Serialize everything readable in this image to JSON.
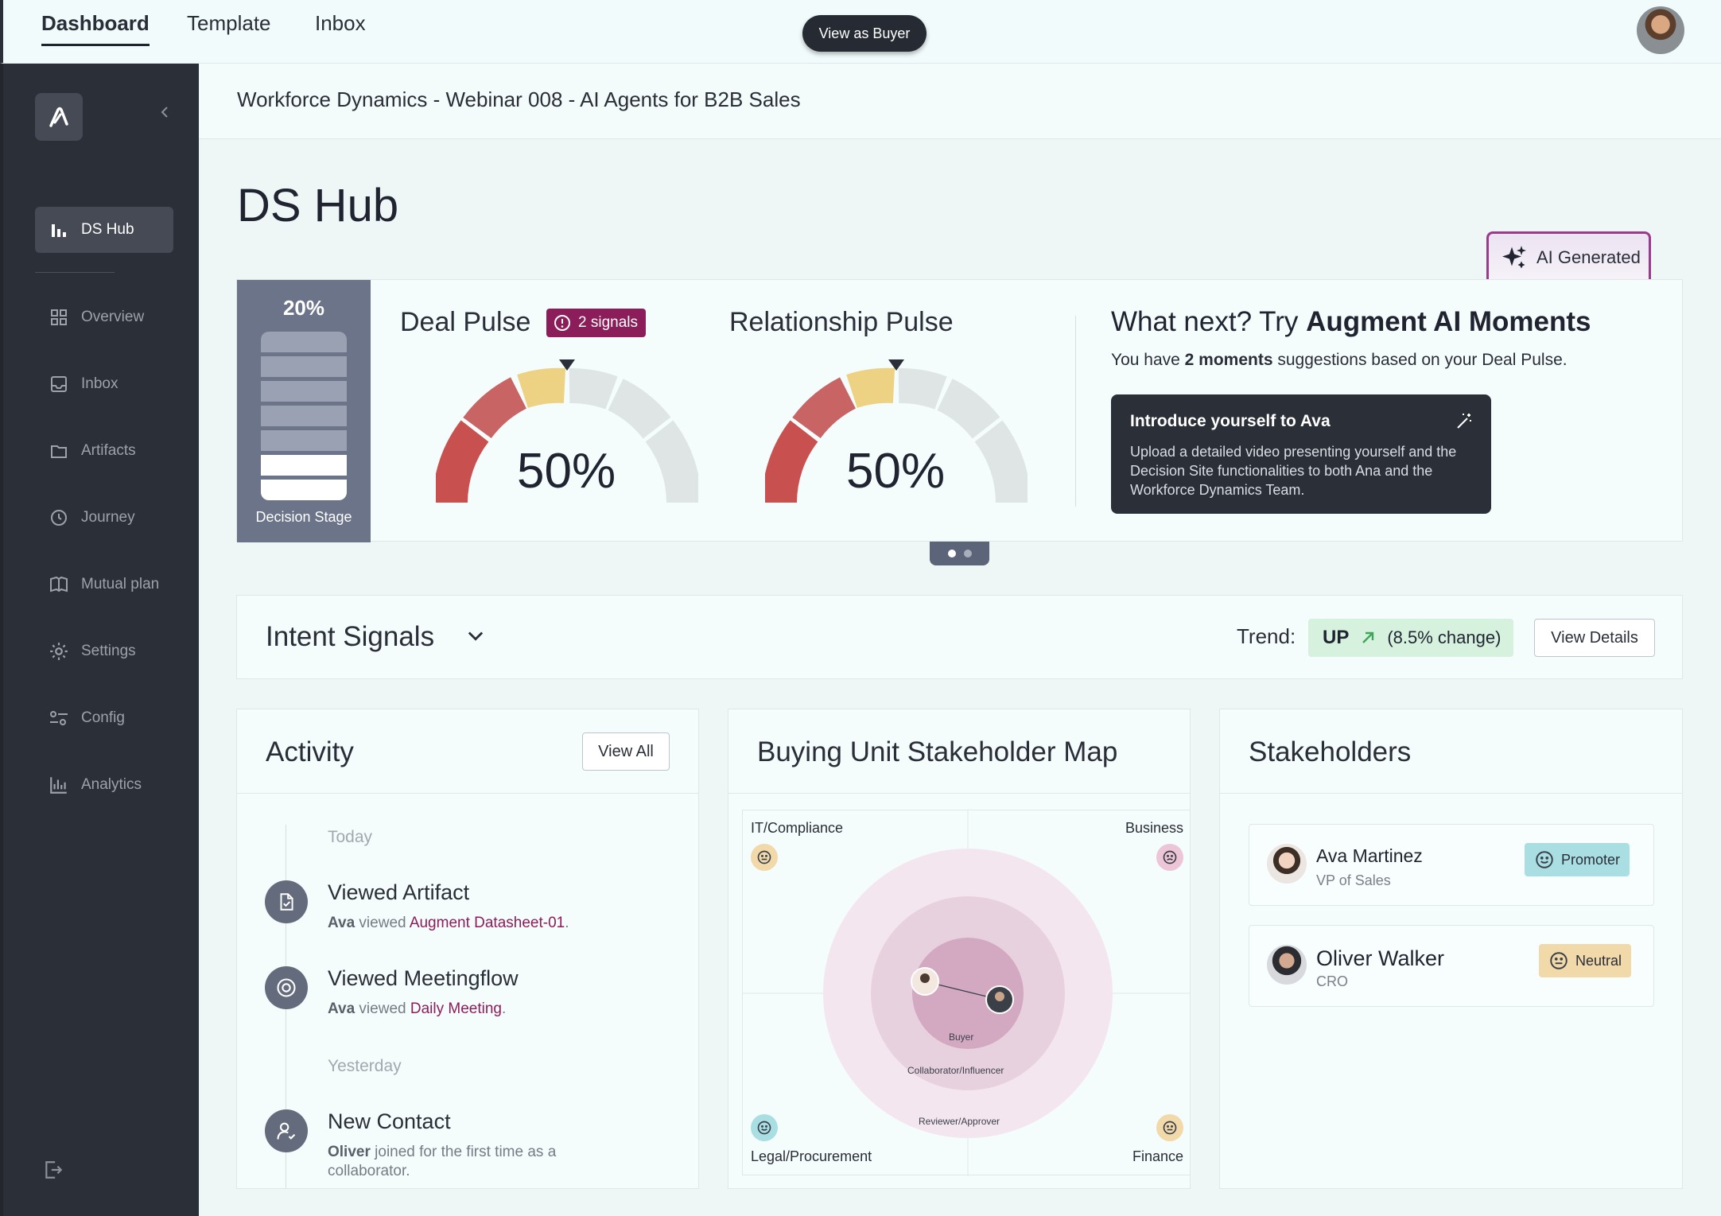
{
  "topnav": {
    "tabs": [
      {
        "label": "Dashboard",
        "active": true
      },
      {
        "label": "Template",
        "active": false
      },
      {
        "label": "Inbox",
        "active": false
      }
    ],
    "view_as_buyer": "View as Buyer"
  },
  "sidebar": {
    "items": [
      {
        "label": "DS Hub",
        "icon": "bar-chart-icon",
        "active": true
      },
      {
        "label": "Overview",
        "icon": "grid-icon"
      },
      {
        "label": "Inbox",
        "icon": "inbox-icon"
      },
      {
        "label": "Artifacts",
        "icon": "folder-icon"
      },
      {
        "label": "Journey",
        "icon": "clock-icon"
      },
      {
        "label": "Mutual plan",
        "icon": "book-icon"
      },
      {
        "label": "Settings",
        "icon": "gear-icon"
      },
      {
        "label": "Config",
        "icon": "sliders-icon"
      },
      {
        "label": "Analytics",
        "icon": "analytics-icon"
      }
    ]
  },
  "breadcrumb": "Workforce Dynamics - Webinar 008 - AI Agents for B2B Sales",
  "page_title": "DS Hub",
  "ai_generated": "AI Generated",
  "stage": {
    "percent": "20%",
    "label": "Decision Stage"
  },
  "deal_pulse": {
    "title": "Deal Pulse",
    "signals": "2 signals",
    "value": "50%"
  },
  "relationship_pulse": {
    "title": "Relationship Pulse",
    "value": "50%"
  },
  "what_next": {
    "title_prefix": "What next? Try ",
    "title_bold": "Augment AI Moments",
    "sub_prefix": "You have ",
    "sub_bold": "2 moments",
    "sub_suffix": " suggestions based on your Deal Pulse.",
    "moment_title": "Introduce yourself to Ava",
    "moment_body": "Upload a detailed video presenting yourself and the Decision Site functionalities to both Ana and the Workforce Dynamics Team."
  },
  "intent": {
    "title": "Intent Signals",
    "trend_label": "Trend:",
    "trend_dir": "UP",
    "trend_change": "(8.5% change)",
    "view_details": "View Details"
  },
  "activity": {
    "title": "Activity",
    "view_all": "View All",
    "today": "Today",
    "yesterday": "Yesterday",
    "items": [
      {
        "title": "Viewed Artifact",
        "actor": "Ava",
        "verb": " viewed ",
        "target": "Augment Datasheet-01",
        "end": "."
      },
      {
        "title": "Viewed Meetingflow",
        "actor": "Ava",
        "verb": " viewed ",
        "target": "Daily Meeting",
        "end": "."
      },
      {
        "title": "New Contact",
        "actor": "Oliver",
        "verb": " joined for the first time as a collaborator."
      }
    ]
  },
  "stakeholder_map": {
    "title": "Buying Unit Stakeholder Map",
    "quadrants": {
      "tl": "IT/Compliance",
      "tr": "Business",
      "bl": "Legal/Procurement",
      "br": "Finance"
    },
    "rings": {
      "inner": "Buyer",
      "middle": "Collaborator/Influencer",
      "outer": "Reviewer/Approver"
    }
  },
  "stakeholders": {
    "title": "Stakeholders",
    "people": [
      {
        "name": "Ava Martinez",
        "role": "VP of Sales",
        "sentiment": "Promoter",
        "color": "#a9dfe2"
      },
      {
        "name": "Oliver Walker",
        "role": "CRO",
        "sentiment": "Neutral",
        "color": "#f1d9a9"
      }
    ]
  },
  "colors": {
    "accent": "#8b1d5a",
    "sidebar": "#2b2f38",
    "gauge_red": "#c8504f",
    "gauge_yellow": "#ecd282",
    "gauge_grey": "#dfe5e5"
  }
}
